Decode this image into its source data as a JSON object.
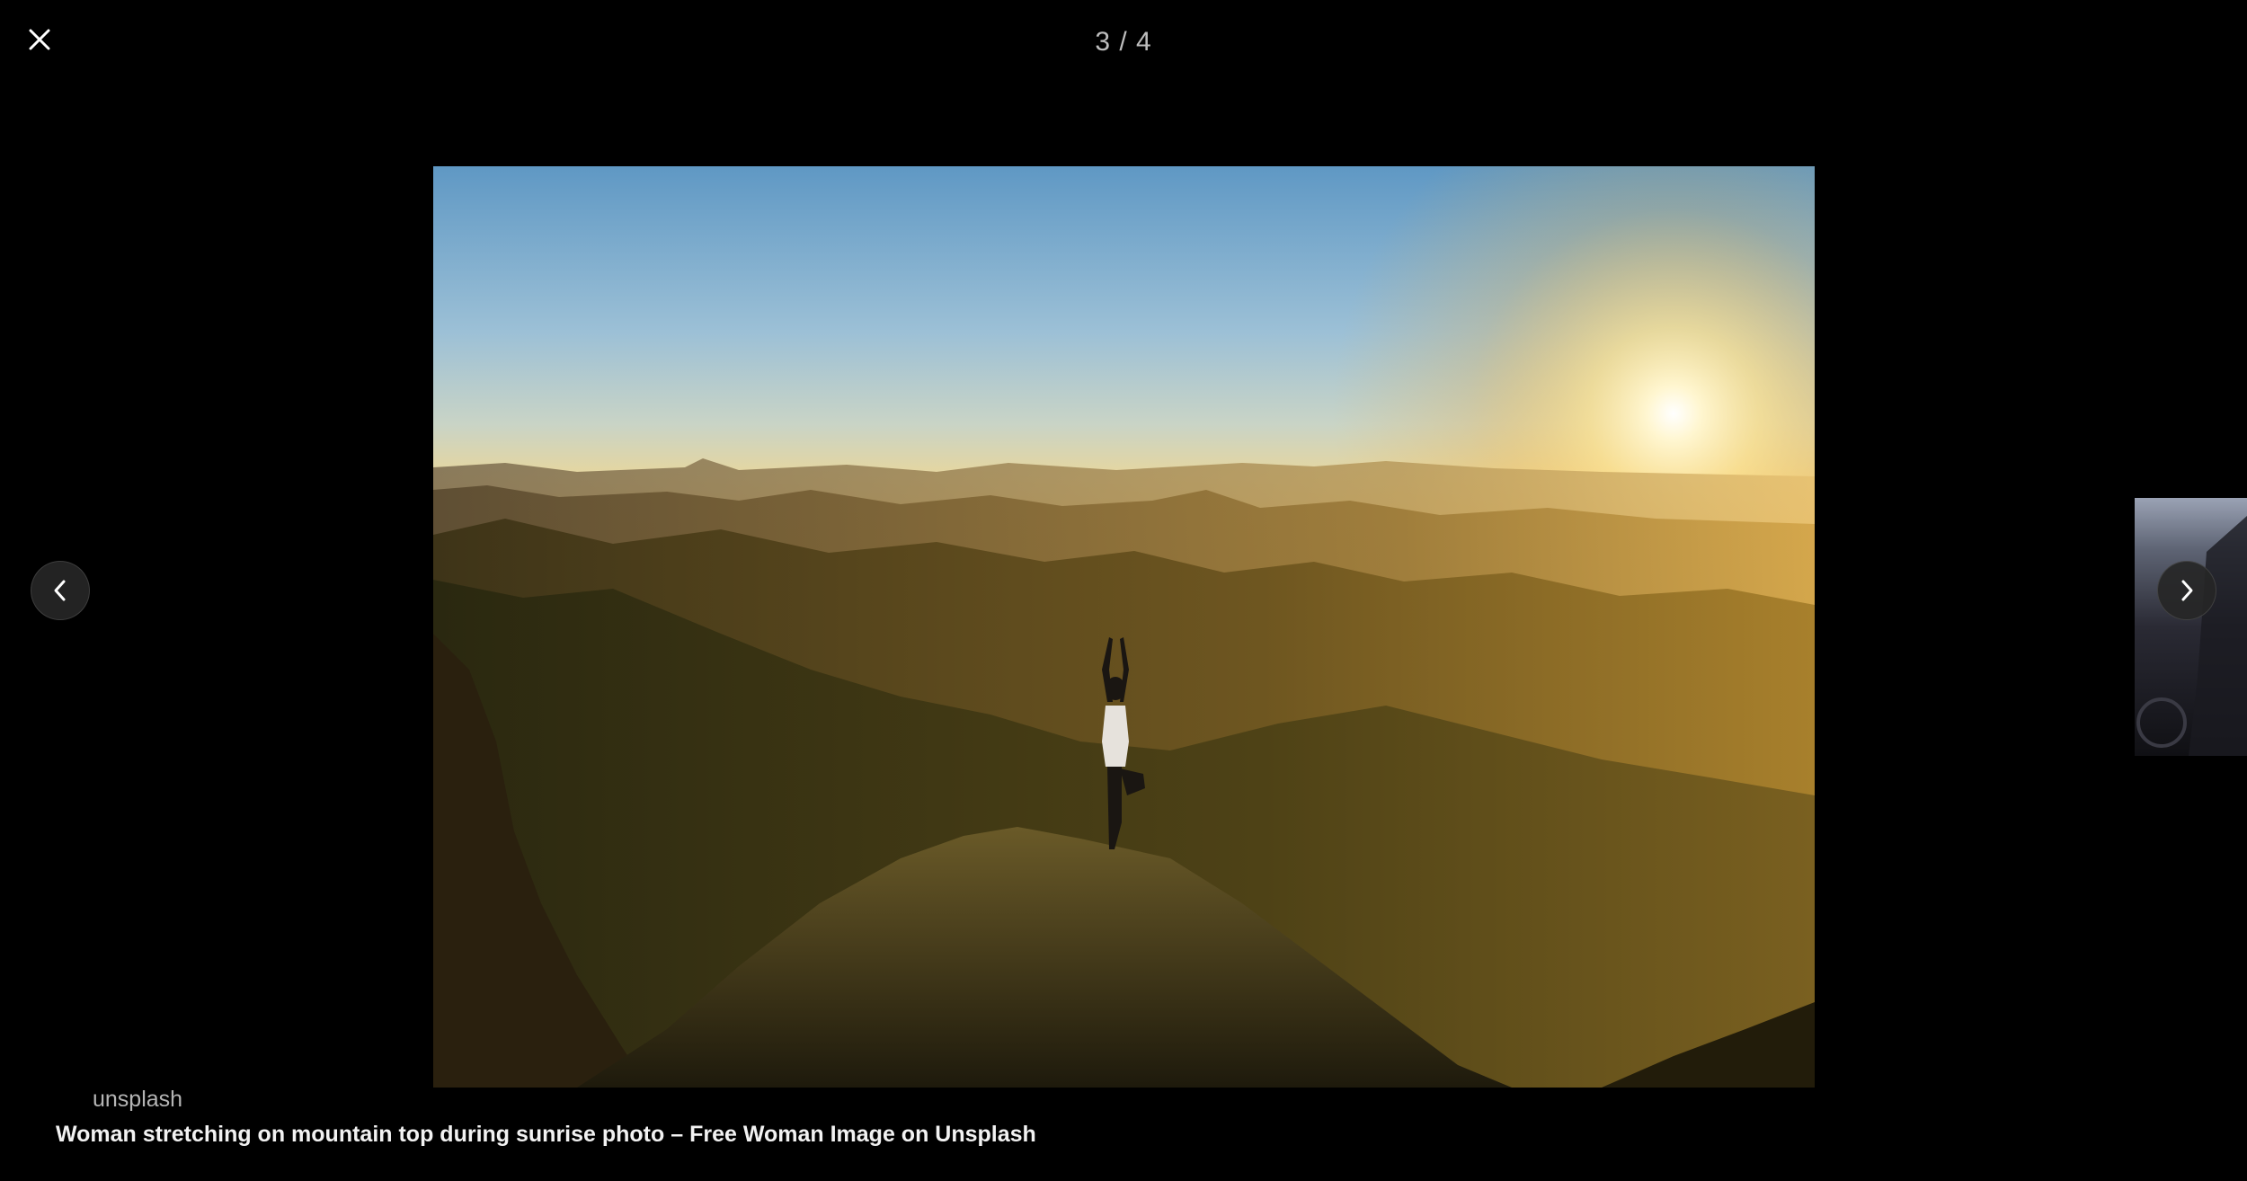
{
  "viewer": {
    "counter": "3 / 4",
    "source": "unsplash",
    "title": "Woman stretching on mountain top during sunrise photo – Free Woman Image on Unsplash"
  },
  "icons": {
    "close": "close-icon",
    "prev": "chevron-left-icon",
    "next": "chevron-right-icon"
  },
  "colors": {
    "background": "#000000",
    "nav_button": "#262626",
    "counter_text": "#bdbdbd",
    "sky_top": "#5a95c2",
    "sun_glow": "#ffe9a8"
  }
}
